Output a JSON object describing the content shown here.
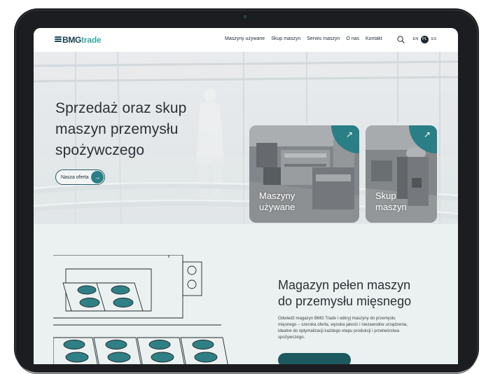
{
  "header": {
    "logo": {
      "part1": "BMG",
      "part2": "trade"
    },
    "nav": [
      "Maszyny używane",
      "Skup maszyn",
      "Serwis maszyn",
      "O nas",
      "Kontakt"
    ],
    "languages": [
      "EN",
      "PL",
      "ES"
    ],
    "active_language": "PL"
  },
  "hero": {
    "title_lines": [
      "Sprzedaż oraz skup",
      "maszyn przemysłu",
      "spożywczego"
    ],
    "cta_label": "Nasza oferta",
    "cards": [
      {
        "label_lines": [
          "Maszyny",
          "używane"
        ],
        "icon": "arrow-up-right-icon"
      },
      {
        "label_lines": [
          "Skup",
          "maszyn"
        ],
        "icon": "arrow-up-right-icon"
      }
    ]
  },
  "section": {
    "title_lines": [
      "Magazyn pełen maszyn",
      "do przemysłu mięsnego"
    ],
    "text_lines": [
      "Odwiedź magazyn BMG Trade i odkryj maszyny do przemysłu",
      "mięsnego – szeroka oferta, wysoka jakość i niezawodne urządzenia,",
      "idealne do optymalizacji każdego etapu produkcji i przetwórstwa",
      "spożywczego."
    ]
  },
  "colors": {
    "accent": "#2a7f86",
    "dark": "#1d2b30",
    "logo_accent": "#3aa8a8"
  }
}
